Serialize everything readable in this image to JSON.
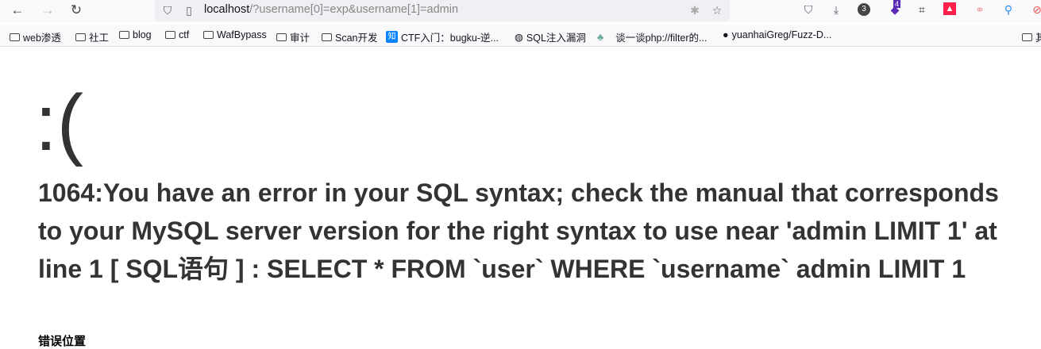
{
  "browser": {
    "url_host": "localhost",
    "url_rest": "/?username[0]=exp&username[1]=admin",
    "badge_count": "3",
    "ext_badge": "4"
  },
  "bookmarks": [
    {
      "label": "web渗透",
      "icon": "folder"
    },
    {
      "label": "社工",
      "icon": "folder"
    },
    {
      "label": "blog",
      "icon": "folder"
    },
    {
      "label": "ctf",
      "icon": "folder"
    },
    {
      "label": "WafBypass",
      "icon": "folder"
    },
    {
      "label": "审计",
      "icon": "folder"
    },
    {
      "label": "Scan开发",
      "icon": "folder"
    },
    {
      "label": "CTF入门：bugku-逆...",
      "icon": "zhihu"
    },
    {
      "label": "SQL注入漏洞",
      "icon": "globe"
    },
    {
      "label": "谈一谈php://filter的...",
      "icon": "cactus"
    },
    {
      "label": "yuanhaiGreg/Fuzz-D...",
      "icon": "github"
    },
    {
      "label": "其",
      "icon": "folder"
    }
  ],
  "page": {
    "face": ":(",
    "error": "1064:You have an error in your SQL syntax; check the manual that corresponds to your MySQL server version for the right syntax to use near 'admin LIMIT 1' at line 1 [ SQL语句 ] : SELECT * FROM `user` WHERE `username` admin LIMIT 1",
    "position_heading": "错误位置"
  }
}
